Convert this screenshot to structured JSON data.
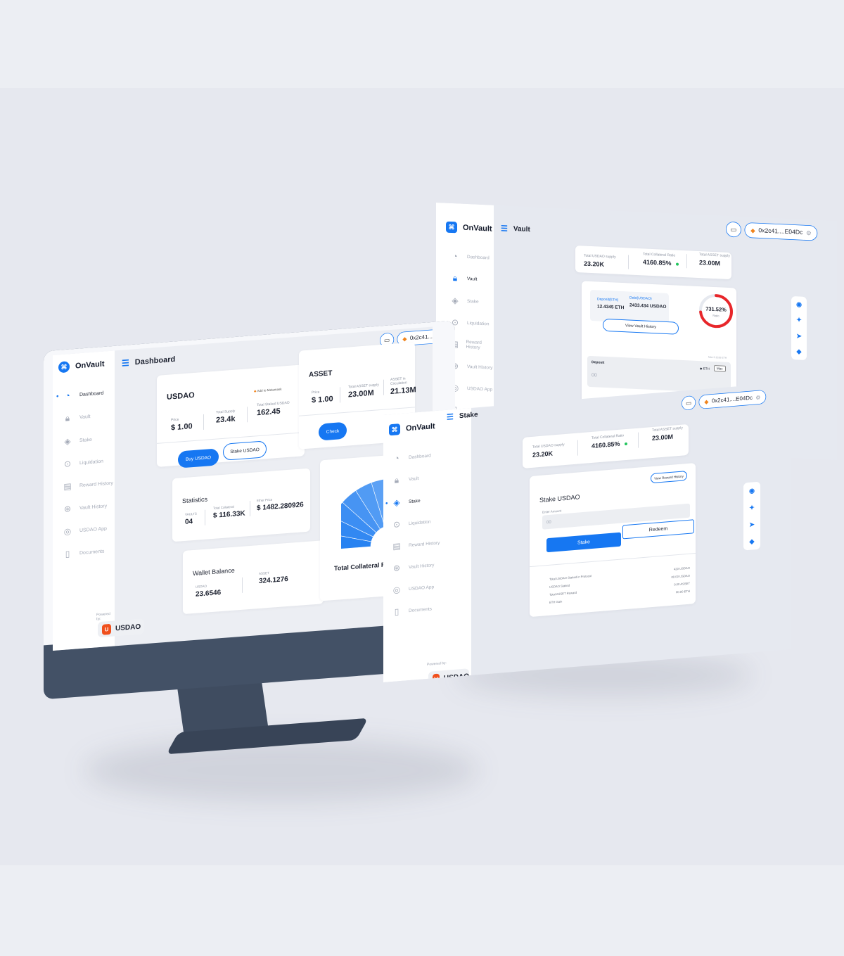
{
  "app": {
    "name": "OnVault"
  },
  "nav": [
    {
      "label": "Dashboard",
      "icon": "gauge-icon"
    },
    {
      "label": "Vault",
      "icon": "lock-icon"
    },
    {
      "label": "Stake",
      "icon": "layers-icon"
    },
    {
      "label": "Liquidation",
      "icon": "shield-icon"
    },
    {
      "label": "Reward History",
      "icon": "receipt-icon"
    },
    {
      "label": "Vault History",
      "icon": "history-icon"
    },
    {
      "label": "USDAO App",
      "icon": "app-icon"
    },
    {
      "label": "Documents",
      "icon": "document-icon"
    }
  ],
  "powered": {
    "label": "Powered by:",
    "brand": "USDAO"
  },
  "wallet": {
    "address": "0x2c41....E04Dc"
  },
  "dashboard": {
    "title": "Dashboard",
    "usdao": {
      "title": "USDAO",
      "add_metamask": "Add to Metamask",
      "price_label": "Price",
      "price": "$ 1.00",
      "supply_label": "Total Supply",
      "supply": "23.4k",
      "staked_label": "Total Staked USDAO",
      "staked": "162.45",
      "buy_label": "Buy USDAO",
      "stake_label": "Stake USDAO"
    },
    "asset": {
      "title": "ASSET",
      "price_label": "Price",
      "price": "$ 1.00",
      "supply_label": "Total ASSET supply",
      "supply": "23.00M",
      "circ_label": "ASSET in Circulation",
      "circ": "21.13M",
      "check_label": "Check"
    },
    "statistics": {
      "title": "Statistics",
      "vaults_label": "VAULTS",
      "vaults": "04",
      "collateral_label": "Total Collateral",
      "collateral": "$ 116.33K",
      "ether_label": "Ether Price",
      "ether": "$ 1482.280926"
    },
    "wallet_balance": {
      "title": "Wallet Balance",
      "usdao_label": "USDAO",
      "usdao": "23.6546",
      "asset_label": "ASSET",
      "asset": "324.1276"
    },
    "gauge": {
      "title": "Total Collateral Rati"
    }
  },
  "vault": {
    "title": "Vault",
    "stats": [
      {
        "label": "Total USDAO supply",
        "value": "23.20K"
      },
      {
        "label": "Total Collateral Ratio",
        "value": "4160.85%"
      },
      {
        "label": "Total ASSET supply",
        "value": "23.00M"
      }
    ],
    "deposit_label": "Deposit(ETH)",
    "deposit": "12.4345 ETH",
    "debt_label": "Debt(USDAO)",
    "debt": "2433.434 USDAO",
    "history_label": "View Vault History",
    "ratio": 0.7315,
    "ratio_value": "731.52%",
    "ratio_label": "Ratio",
    "form_label": "Deposit",
    "form_placeholder": "00",
    "currency": "ETH",
    "max_label": "Max",
    "note": "Max 0.1316 ETH"
  },
  "stake": {
    "title": "Stake",
    "stats": [
      {
        "label": "Total USDAO supply",
        "value": "23.20K"
      },
      {
        "label": "Total Collateral Ratio",
        "value": "4160.85%"
      },
      {
        "label": "Total ASSET supply",
        "value": "23.00M"
      }
    ],
    "card_title": "Stake USDAO",
    "reward_history": "View Reward History",
    "amount_label": "Enter Amount",
    "amount_placeholder": "00",
    "stake_button": "Stake",
    "redeem_button": "Redeem",
    "rows": [
      {
        "label": "Total USDAO Staked in Protocol",
        "value": "420 USDAO"
      },
      {
        "label": "USDAO Staked",
        "value": "00.00 USDAO"
      },
      {
        "label": "Total ASSET Reward",
        "value": "0.00 ASSET"
      },
      {
        "label": "ETH Gain",
        "value": "00.00 ETH"
      }
    ]
  },
  "social": [
    {
      "icon": "discord-icon",
      "glyph": "◉"
    },
    {
      "icon": "twitter-icon",
      "glyph": "✦"
    },
    {
      "icon": "telegram-icon",
      "glyph": "➤"
    },
    {
      "icon": "github-icon",
      "glyph": "◆"
    }
  ],
  "colors": {
    "accent": "#1677f2",
    "monitor": "#435166",
    "background": "#e6e8ef"
  }
}
